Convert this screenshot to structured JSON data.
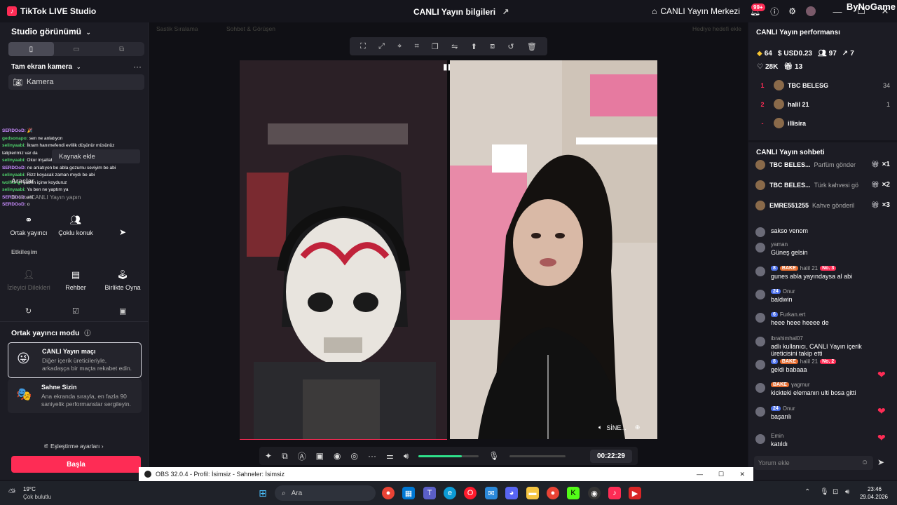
{
  "titlebar": {
    "app_title": "TikTok LIVE Studio",
    "live_info": "CANLI Yayın bilgileri",
    "live_center": "CANLI Yayın Merkezi",
    "notif_count": "99+",
    "watermark": "ByNoGame"
  },
  "left": {
    "studio_view": "Studio görünümü",
    "fullscreen_camera": "Tam ekran kamera",
    "camera": "Kamera",
    "add_source": "Kaynak ekle",
    "tools": "Araçlar",
    "start_live_hint": "Birlikte CANLI Yayın yapın",
    "tiles1": [
      "Ortak yayıncı",
      "Çoklu konuk"
    ],
    "interaction": "Etkileşim",
    "tiles2": [
      "İzleyici Dilekleri",
      "Rehber",
      "Birlikte Oyna"
    ],
    "cohost_mode": "Ortak yayıncı modu",
    "mode_cards": [
      {
        "title": "CANLI Yayın maçı",
        "desc": "Diğer içerik üreticileriyle, arkadaşça bir maçta rekabet edin."
      },
      {
        "title": "Sahne Sizin",
        "desc": "Ana ekranda sırayla, en fazla 90 saniyelik performanslar sergileyin."
      }
    ],
    "match_settings": "Eşleştirme ayarları",
    "start_button": "Başla",
    "chat_overlay": [
      {
        "user": "SERDOoD:",
        "text": "🎉",
        "cls": "n"
      },
      {
        "user": "gedsonapo:",
        "text": "sen ne anlatıyon",
        "cls": "g"
      },
      {
        "user": "selinyaabi:",
        "text": "İkram hanımefendi evlilik düşünür müsünüz",
        "cls": "g"
      },
      {
        "user": "",
        "text": "taliplerimiz var da",
        "cls": "g"
      },
      {
        "user": "selinyaabi:",
        "text": "Okur inşallah",
        "cls": "g"
      },
      {
        "user": "SERDOoD:",
        "text": "ne anlatıyon be abla gozumu seviyim be abi",
        "cls": "n"
      },
      {
        "user": "selinyaabi:",
        "text": "Rizz koyacak zaman mıydı be abi",
        "cls": "g"
      },
      {
        "user": "wolfking:",
        "text": "sabrin içinw koyduruz",
        "cls": "g"
      },
      {
        "user": "selinyaabi:",
        "text": "Ya ben ne yaptım ya",
        "cls": "g"
      },
      {
        "user": "SERDOoD:",
        "text": "abi",
        "cls": "n"
      },
      {
        "user": "SERDOoD:",
        "text": "o",
        "cls": "n"
      }
    ]
  },
  "center": {
    "tab_faded1": "Sastik Sıralama",
    "tab_faded2": "Sohbet & Görüşen",
    "tab_faded3": "Hediye hedefi ekle",
    "guest_label": "SİNE...",
    "timer": "00:22:29",
    "audio_level": 0.72
  },
  "right": {
    "performance_title": "CANLI Yayın performansı",
    "stats": [
      {
        "icon": "coin-icon",
        "value": "64"
      },
      {
        "icon": "dollar-icon",
        "value": "USD0.23"
      },
      {
        "icon": "viewers-icon",
        "value": "97"
      },
      {
        "icon": "share-icon",
        "value": "7"
      }
    ],
    "stats2": [
      {
        "icon": "heart-icon",
        "value": "28K"
      },
      {
        "icon": "gift-icon",
        "value": "13"
      }
    ],
    "ranking": [
      {
        "rank": "1",
        "name": "TBC BELESG",
        "value": "34"
      },
      {
        "rank": "2",
        "name": "halil 21",
        "value": "1"
      },
      {
        "rank": "-",
        "name": "illisira",
        "value": ""
      }
    ],
    "chat_title": "CANLI Yayın sohbeti",
    "gifts": [
      {
        "user": "TBC BELES...",
        "text": "Parfüm gönder",
        "count": "×1"
      },
      {
        "user": "TBC BELES...",
        "text": "Türk kahvesi gö",
        "count": "×2"
      },
      {
        "user": "EMRE551255",
        "text": "Kahve gönderil",
        "count": "×3"
      }
    ],
    "messages": [
      {
        "user": "",
        "text": "sakso venom"
      },
      {
        "user": "yaman",
        "text": "Güneş gelsin"
      },
      {
        "user": "halil 21",
        "level": "8",
        "team": "BAKE",
        "rank": "No. 3",
        "text": "gunes abla yayındaysa al abi"
      },
      {
        "user": "Onur",
        "level": "24",
        "text": "baldwin"
      },
      {
        "user": "Furkan.ert",
        "level": "6",
        "text": "heee heee heeee de"
      },
      {
        "user": "ibrahimhal07",
        "text": "adlı kullanıcı, CANLI Yayın içerik üreticisini takip etti"
      },
      {
        "user": "halil 21",
        "level": "8",
        "team": "BAKE",
        "rank": "No. 2",
        "text": "geldi babaaa"
      },
      {
        "user": "ɣagmur",
        "team": "BAKE",
        "text": "kickteki elemanın ulti bosa gitti"
      },
      {
        "user": "Onur",
        "level": "24",
        "text": "başarılı"
      },
      {
        "user": "Emin",
        "text": "katıldı"
      }
    ],
    "comment_placeholder": "Yorum ekle"
  },
  "obs": {
    "title": "OBS 32.0.4 - Profil: İsimsiz - Sahneler: İsimsiz"
  },
  "taskbar": {
    "temp": "19°C",
    "weather": "Çok bulutlu",
    "search": "Ara",
    "time": "23:46",
    "date": "29.04.2026"
  },
  "colors": {
    "accent": "#fe2c55",
    "panel": "#1c1c24",
    "background": "#15151c"
  }
}
